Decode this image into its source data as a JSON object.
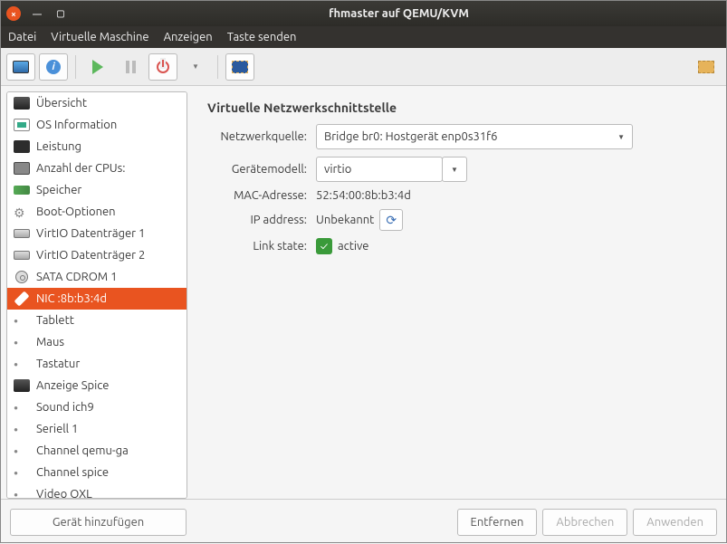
{
  "window": {
    "title": "fhmaster auf QEMU/KVM"
  },
  "menu": {
    "file": "Datei",
    "vm": "Virtuelle Maschine",
    "view": "Anzeigen",
    "sendkey": "Taste senden"
  },
  "sidebar": {
    "items": [
      {
        "label": "Übersicht"
      },
      {
        "label": "OS Information"
      },
      {
        "label": "Leistung"
      },
      {
        "label": "Anzahl der CPUs:"
      },
      {
        "label": "Speicher"
      },
      {
        "label": "Boot-Optionen"
      },
      {
        "label": "VirtIO Datenträger 1"
      },
      {
        "label": "VirtIO Datenträger 2"
      },
      {
        "label": "SATA CDROM 1"
      },
      {
        "label": "NIC :8b:b3:4d"
      },
      {
        "label": "Tablett"
      },
      {
        "label": "Maus"
      },
      {
        "label": "Tastatur"
      },
      {
        "label": "Anzeige Spice"
      },
      {
        "label": "Sound ich9"
      },
      {
        "label": "Seriell 1"
      },
      {
        "label": "Channel qemu-ga"
      },
      {
        "label": "Channel spice"
      },
      {
        "label": "Video QXL"
      }
    ],
    "selected_index": 9
  },
  "panel": {
    "title": "Virtuelle Netzwerkschnittstelle",
    "netsource_label": "Netzwerkquelle:",
    "netsource_value": "Bridge br0: Hostgerät enp0s31f6",
    "devmodel_label": "Gerätemodell:",
    "devmodel_value": "virtio",
    "mac_label": "MAC-Adresse:",
    "mac_value": "52:54:00:8b:b3:4d",
    "ip_label": "IP address:",
    "ip_value": "Unbekannt",
    "link_label": "Link state:",
    "link_value": "active"
  },
  "footer": {
    "add": "Gerät hinzufügen",
    "remove": "Entfernen",
    "cancel": "Abbrechen",
    "apply": "Anwenden"
  }
}
